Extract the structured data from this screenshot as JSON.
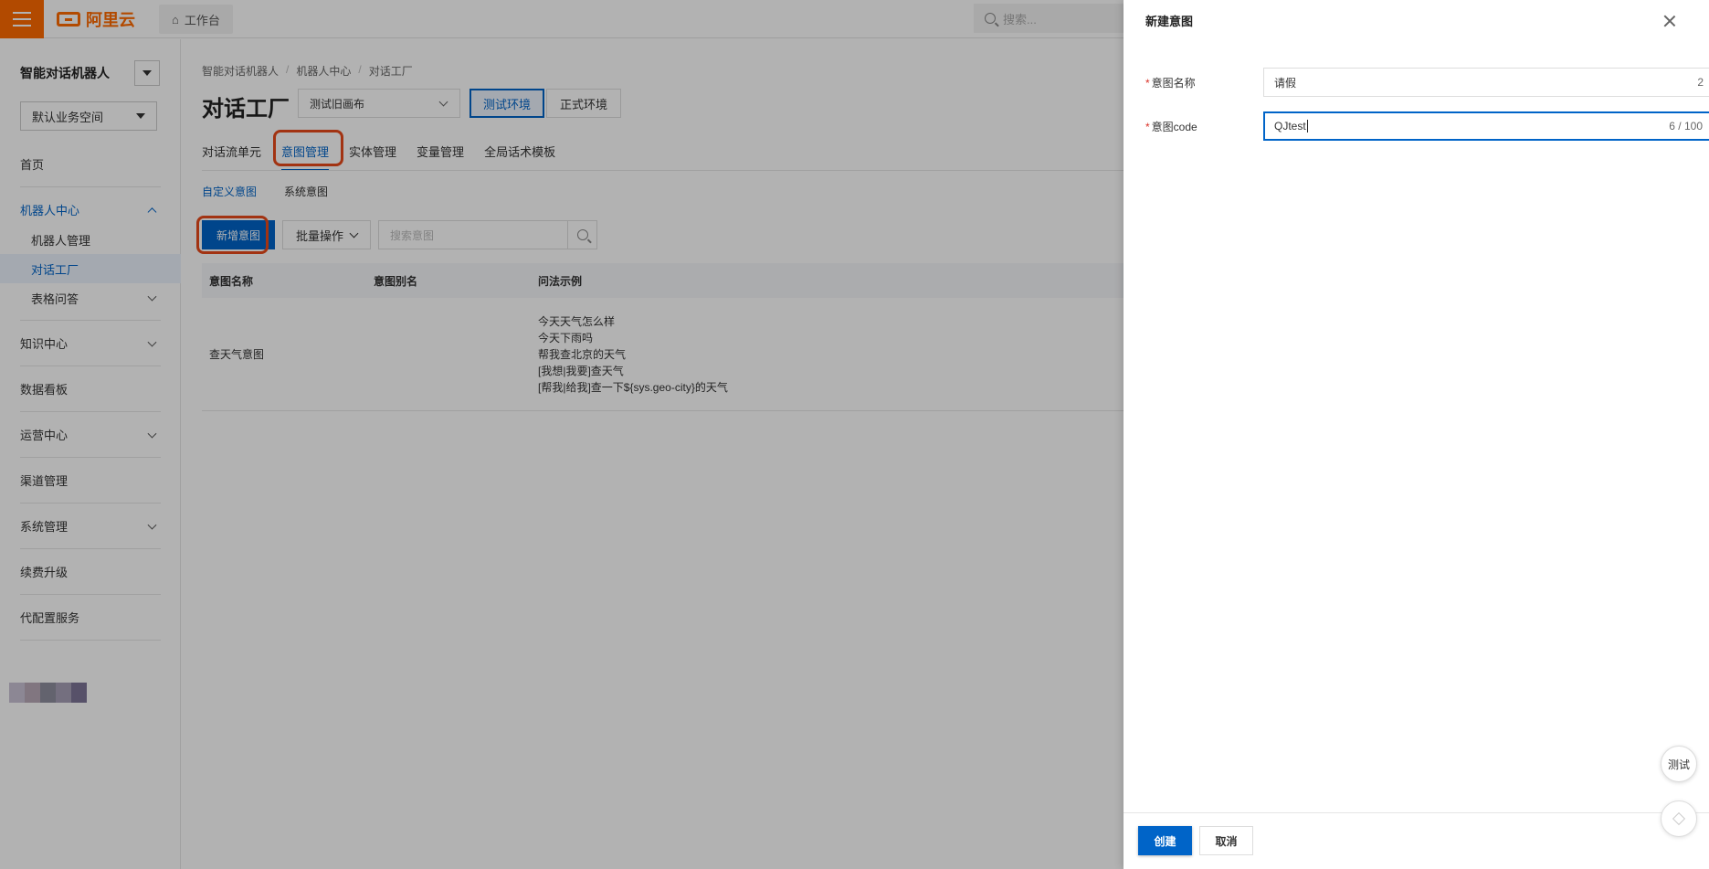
{
  "topbar": {
    "logo_text": "阿里云",
    "workbench_label": "工作台",
    "search_placeholder": "搜索..."
  },
  "sidebar": {
    "robot_name": "智能对话机器人",
    "space": "默认业务空间",
    "items": {
      "home": "首页",
      "robot_center": "机器人中心",
      "robot_manage": "机器人管理",
      "dialog_factory": "对话工厂",
      "table_qa": "表格问答",
      "knowledge": "知识中心",
      "dashboard": "数据看板",
      "operation": "运营中心",
      "channel": "渠道管理",
      "system": "系统管理",
      "renew": "续费升级",
      "proxy": "代配置服务"
    }
  },
  "main": {
    "breadcrumb": [
      "智能对话机器人",
      "机器人中心",
      "对话工厂"
    ],
    "title": "对话工厂",
    "version": "测试旧画布",
    "env_test": "测试环境",
    "env_prod": "正式环境",
    "tabs": [
      "对话流单元",
      "意图管理",
      "实体管理",
      "变量管理",
      "全局话术模板"
    ],
    "subtabs": [
      "自定义意图",
      "系统意图"
    ],
    "add_button": "新增意图",
    "batch_button": "批量操作",
    "search_placeholder": "搜索意图",
    "table": {
      "headers": [
        "意图名称",
        "意图别名",
        "问法示例"
      ],
      "rows": [
        {
          "name": "查天气意图",
          "alias": "",
          "examples": [
            "今天天气怎么样",
            "今天下雨吗",
            "帮我查北京的天气",
            "[我想|我要]查天气",
            "[帮我|给我]查一下${sys.geo-city}的天气"
          ]
        }
      ]
    }
  },
  "drawer": {
    "title": "新建意图",
    "name_label": "意图名称",
    "name_value": "请假",
    "name_count": "2",
    "code_label": "意图code",
    "code_value": "QJtest",
    "code_count": "6 / 100",
    "create_button": "创建",
    "cancel_button": "取消"
  },
  "floating": {
    "test_label": "测试"
  },
  "colors": {
    "accent": "#0064c8",
    "brand": "#ff6a00",
    "highlight": "#e84a1a",
    "required": "#d93026"
  }
}
